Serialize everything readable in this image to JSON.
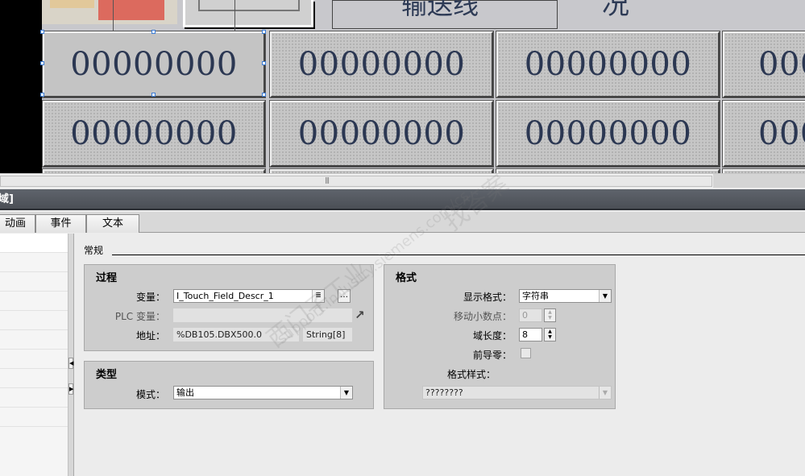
{
  "canvas": {
    "cells": [
      {
        "value": "00000000"
      },
      {
        "value": "00000000"
      },
      {
        "value": "00000000"
      },
      {
        "value": "000"
      },
      {
        "value": "00000000"
      },
      {
        "value": "00000000"
      },
      {
        "value": "00000000"
      },
      {
        "value": "000"
      }
    ],
    "top_field_text": "输送线",
    "top_right_text": "况"
  },
  "inspector": {
    "title": "域]",
    "tabs": [
      "动画",
      "事件",
      "文本"
    ]
  },
  "general": {
    "section_title": "常规",
    "process": {
      "title": "过程",
      "variable_label": "变量：",
      "variable_value": "I_Touch_Field_Descr_1",
      "plc_variable_label": "PLC 变量：",
      "plc_variable_value": "",
      "address_label": "地址：",
      "address_value": "%DB105.DBX500.0",
      "datatype_value": "String[8]"
    },
    "type": {
      "title": "类型",
      "mode_label": "模式：",
      "mode_value": "输出"
    },
    "format": {
      "title": "格式",
      "display_format_label": "显示格式：",
      "display_format_value": "字符串",
      "shift_decimal_label": "移动小数点：",
      "shift_decimal_value": "0",
      "field_length_label": "域长度：",
      "field_length_value": "8",
      "leading_zeros_label": "前导零：",
      "format_pattern_label": "格式样式：",
      "format_pattern_value": "????????"
    }
  },
  "watermark": {
    "line1": "西门子工业",
    "line2": "support.industry.siemens.com/cs",
    "line3": "找答案"
  }
}
